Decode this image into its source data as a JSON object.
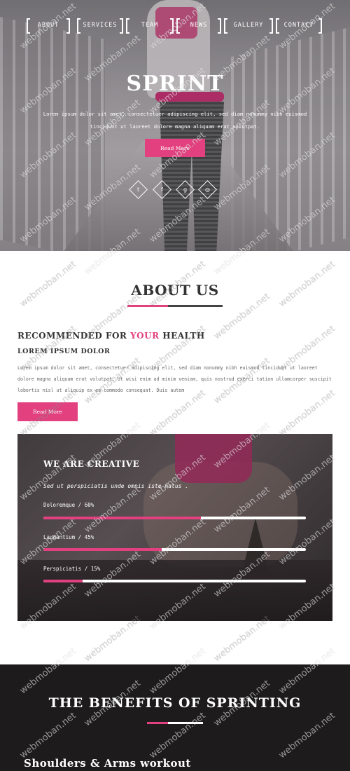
{
  "nav": {
    "items": [
      {
        "label": "About"
      },
      {
        "label": "Services"
      },
      {
        "label": "Team"
      },
      {
        "label": "News"
      },
      {
        "label": "Gallery"
      },
      {
        "label": "Contact"
      }
    ]
  },
  "hero": {
    "title": "SPRINT",
    "text": "Lorem ipsum dolor sit amet, consectetuer adipiscing elit, sed diam nonummy nibh euismod tincidunt ut laoreet dolore magna aliquam erat volutpat.",
    "button_label": "Read More",
    "socials": [
      {
        "icon": "twitter-icon",
        "glyph": "𝕥"
      },
      {
        "icon": "facebook-icon",
        "glyph": "f"
      },
      {
        "icon": "google-plus-icon",
        "glyph": "g"
      },
      {
        "icon": "dribbble-icon",
        "glyph": "⊕"
      }
    ]
  },
  "about": {
    "title": "ABOUT US",
    "heading_pre": "RECOMMENDED FOR ",
    "heading_accent": "YOUR",
    "heading_post": " HEALTH",
    "subheading": "LOREM IPSUM DOLOR",
    "body": "Lorem ipsum dolor sit amet, consectetuer adipiscing elit, sed diam nonummy nibh euismod tincidunt ut laoreet dolore magna aliquam erat volutpat. Ut wisi enim ad minim veniam, quis nostrud exerci tation ullamcorper suscipit lobortis nisl ut aliquip ex ea commodo consequat. Duis autem",
    "button_label": "Read More"
  },
  "creative": {
    "title": "WE ARE CREATIVE",
    "subtitle": "Sed ut perspiciatis unde omnis iste natus .",
    "skills": [
      {
        "label": "Doloremque / 60%",
        "percent": 60
      },
      {
        "label": "Laudantium / 45%",
        "percent": 45
      },
      {
        "label": "Perspiciatis / 15%",
        "percent": 15
      }
    ]
  },
  "benefits": {
    "title": "THE BENEFITS OF SPRINTING",
    "first_item": "Shoulders & Arms workout"
  },
  "watermark": "webmoban.net",
  "colors": {
    "accent": "#e2407f",
    "dark_section": "#1d1b1c"
  }
}
